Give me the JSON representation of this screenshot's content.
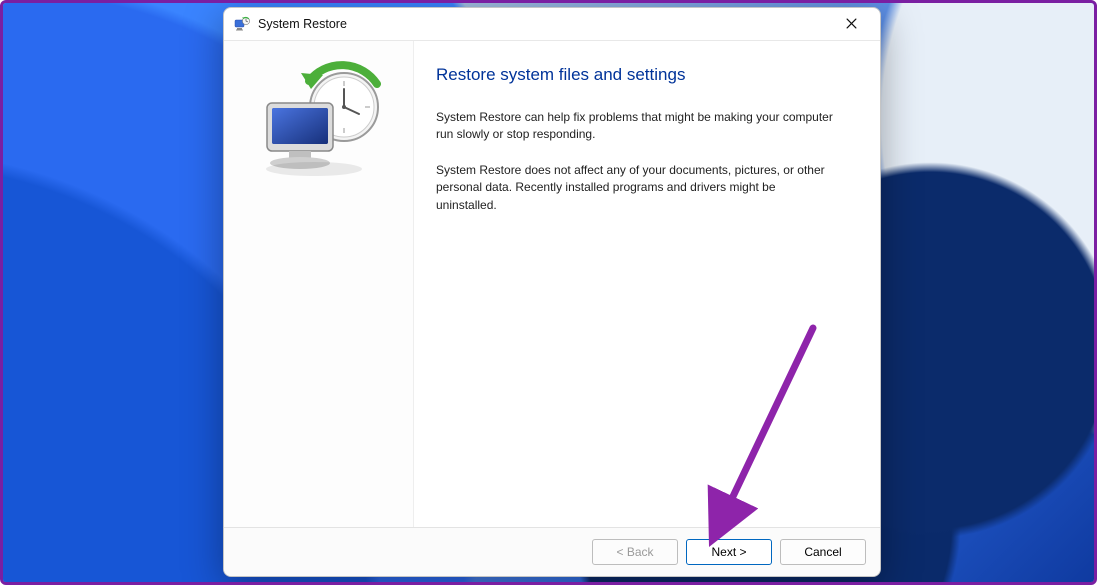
{
  "window": {
    "title": "System Restore"
  },
  "content": {
    "heading": "Restore system files and settings",
    "para1": "System Restore can help fix problems that might be making your computer run slowly or stop responding.",
    "para2": "System Restore does not affect any of your documents, pictures, or other personal data. Recently installed programs and drivers might be uninstalled."
  },
  "buttons": {
    "back": "< Back",
    "next": "Next >",
    "cancel": "Cancel"
  }
}
